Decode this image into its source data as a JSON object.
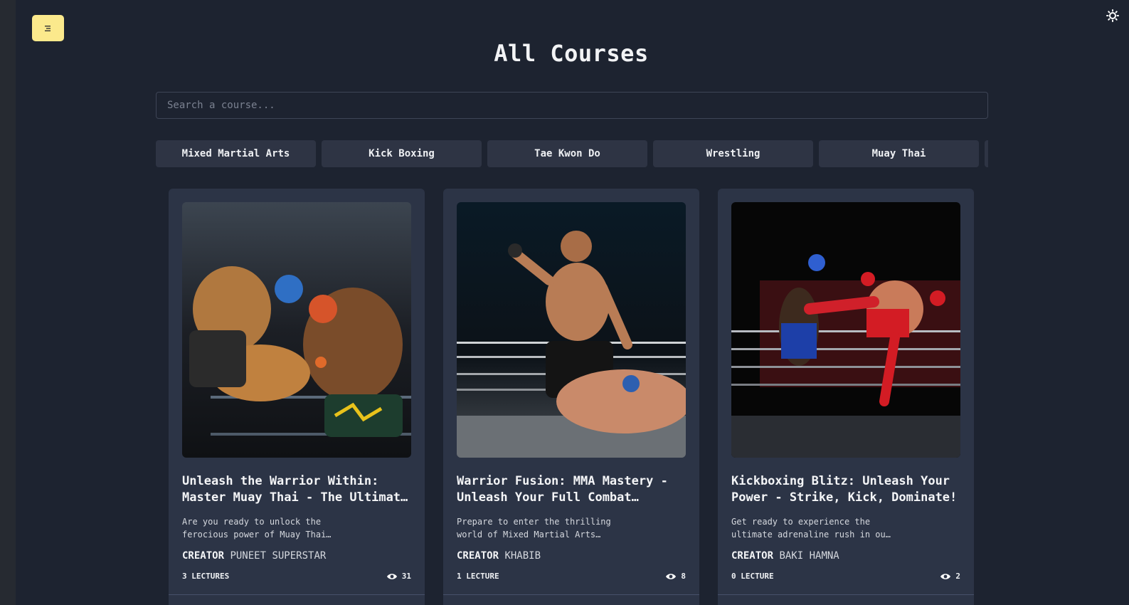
{
  "header": {
    "menu_icon": "menu-icon",
    "theme_icon": "sun-icon",
    "title": "All Courses"
  },
  "search": {
    "placeholder": "Search a course..."
  },
  "categories": [
    "Mixed Martial Arts",
    "Kick Boxing",
    "Tae Kwon Do",
    "Wrestling",
    "Muay Thai",
    ""
  ],
  "courses": [
    {
      "title": "Unleash the Warrior Within: Master Muay Thai - The Ultimate Guide",
      "description": "Are you ready to unlock the ferocious power of Muay Thai and transform yourself",
      "creator_label": "CREATOR",
      "creator": "PUNEET SUPERSTAR",
      "lectures": "3 LECTURES",
      "views": "31"
    },
    {
      "title": "Warrior Fusion: MMA Mastery - Unleash Your Full Combat Potential",
      "description": "Prepare to enter the thrilling world of Mixed Martial Arts (MMA) with this course",
      "creator_label": "CREATOR",
      "creator": "KHABIB",
      "lectures": "1 LECTURE",
      "views": "8"
    },
    {
      "title": "Kickboxing Blitz: Unleash Your Power - Strike, Kick, Dominate!",
      "description": "Get ready to experience the ultimate adrenaline rush in our kickboxing course",
      "creator_label": "CREATOR",
      "creator": "BAKI HAMNA",
      "lectures": "0 LECTURE",
      "views": "2"
    }
  ],
  "colors": {
    "background": "#1d2330",
    "card": "#2c3446",
    "chip": "#2e3444",
    "accent": "#fbe98c"
  }
}
